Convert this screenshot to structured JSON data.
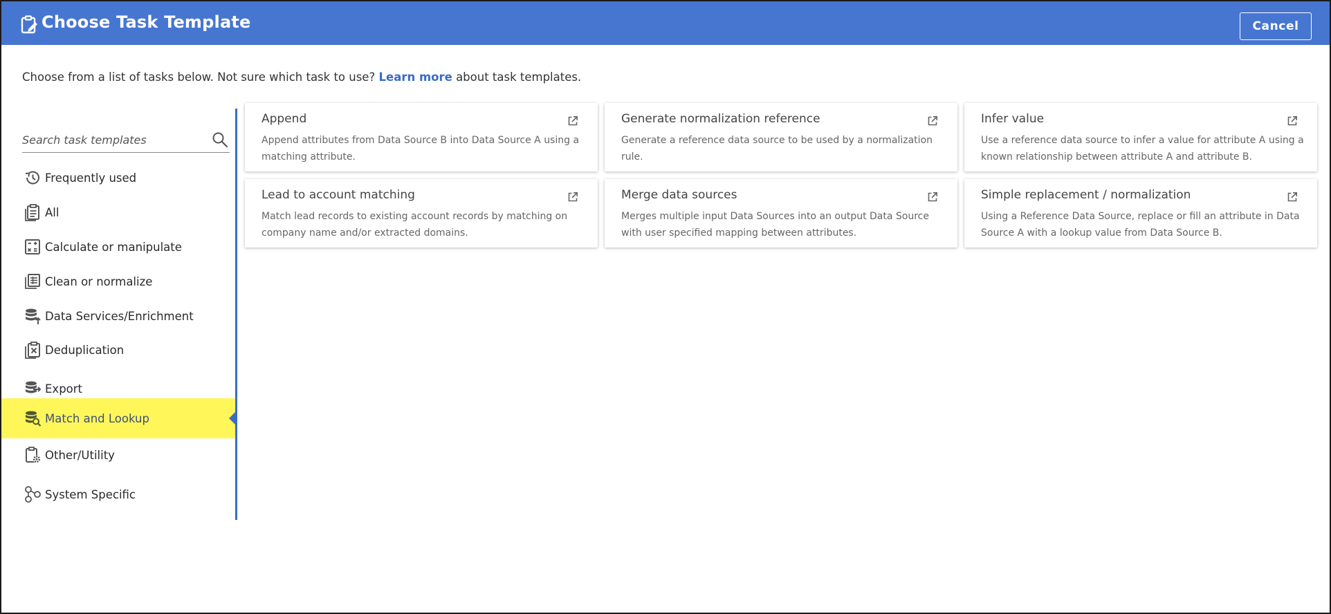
{
  "header": {
    "title": "Choose Task Template",
    "cancel_label": "Cancel",
    "background": "#4776d1"
  },
  "intro": {
    "before": "Choose from a list of tasks below. Not sure which task to use?",
    "link": "Learn more",
    "after": "about task templates."
  },
  "search": {
    "placeholder": "Search task templates",
    "value": ""
  },
  "sidebar": {
    "accent": "#3a6cc8",
    "highlight": "#fff65a",
    "items": [
      {
        "label": "Frequently used",
        "icon": "history-icon"
      },
      {
        "label": "All",
        "icon": "clipboard-list-icon"
      },
      {
        "label": "Calculate or manipulate",
        "icon": "calculator-icon"
      },
      {
        "label": "Clean or normalize",
        "icon": "clean-list-icon"
      },
      {
        "label": "Data Services/Enrichment",
        "icon": "database-enrich-icon"
      },
      {
        "label": "Deduplication",
        "icon": "dedupe-icon"
      },
      {
        "label": "Export",
        "icon": "database-export-icon"
      },
      {
        "label": "Match and Lookup",
        "icon": "database-search-icon",
        "active": true
      },
      {
        "label": "Other/Utility",
        "icon": "clipboard-gear-icon"
      },
      {
        "label": "System Specific",
        "icon": "system-nodes-icon"
      }
    ]
  },
  "cards": [
    {
      "title": "Append",
      "description": "Append attributes from Data Source B into Data Source A using a matching attribute."
    },
    {
      "title": "Generate normalization reference",
      "description": "Generate a reference data source to be used by a normalization rule."
    },
    {
      "title": "Infer value",
      "description": "Use a reference data source to infer a value for attribute A using a known relationship between attribute A and attribute B."
    },
    {
      "title": "Lead to account matching",
      "description": "Match lead records to existing account records by matching on company name and/or extracted domains."
    },
    {
      "title": "Merge data sources",
      "description": "Merges multiple input Data Sources into an output Data Source with user specified mapping between attributes."
    },
    {
      "title": "Simple replacement / normalization",
      "description": "Using a Reference Data Source, replace or fill an attribute in Data Source A with a lookup value from Data Source B."
    }
  ]
}
